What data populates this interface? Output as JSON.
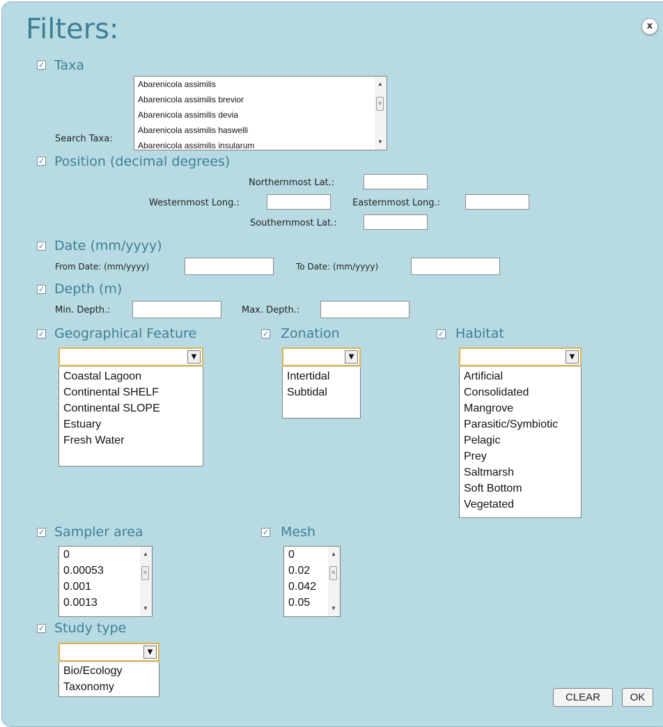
{
  "title": "Filters:",
  "close_symbol": "x",
  "checkbox_mark": "✓",
  "scroll": {
    "up": "▲",
    "down": "▼",
    "thumb": "≡"
  },
  "combo_arrow": "▼",
  "taxa": {
    "label": "Taxa",
    "search_label": "Search Taxa:",
    "options": [
      "Abarenicola assimilis",
      "Abarenicola assimilis brevior",
      "Abarenicola assimilis devia",
      "Abarenicola assimilis haswelli",
      "Abarenicola assimilis insularum"
    ]
  },
  "position": {
    "label": "Position (decimal degrees)",
    "north_label": "Northernmost Lat.:",
    "west_label": "Westernmost Long.:",
    "east_label": "Easternmost Long.:",
    "south_label": "Southernmost Lat.:"
  },
  "date": {
    "label": "Date (mm/yyyy)",
    "from_label": "From Date: (mm/yyyy)",
    "to_label": "To Date: (mm/yyyy)"
  },
  "depth": {
    "label": "Depth (m)",
    "min_label": "Min. Depth.:",
    "max_label": "Max. Depth.:"
  },
  "geo": {
    "label": "Geographical Feature",
    "selected": "",
    "options": [
      "Coastal Lagoon",
      "Continental SHELF",
      "Continental SLOPE",
      "Estuary",
      "Fresh Water"
    ]
  },
  "zonation": {
    "label": "Zonation",
    "selected": "",
    "options": [
      "Intertidal",
      "Subtidal"
    ]
  },
  "habitat": {
    "label": "Habitat",
    "selected": "",
    "options": [
      "Artificial",
      "Consolidated",
      "Mangrove",
      "Parasitic/Symbiotic",
      "Pelagic",
      "Prey",
      "Saltmarsh",
      "Soft Bottom",
      "Vegetated"
    ]
  },
  "sampler": {
    "label": "Sampler area",
    "options": [
      "0",
      "0.00053",
      "0.001",
      "0.0013"
    ]
  },
  "mesh": {
    "label": "Mesh",
    "options": [
      "0",
      "0.02",
      "0.042",
      "0.05"
    ]
  },
  "study": {
    "label": "Study type",
    "selected": "",
    "options": [
      "Bio/Ecology",
      "Taxonomy"
    ]
  },
  "buttons": {
    "clear": "CLEAR",
    "ok": "OK"
  }
}
